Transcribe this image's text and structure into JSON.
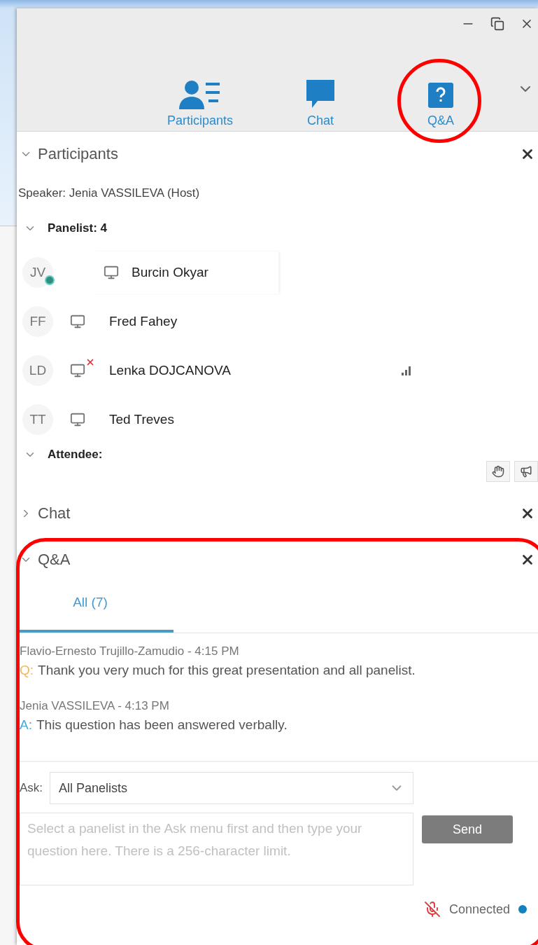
{
  "toolbar": {
    "tabs": [
      {
        "kind": "participants",
        "label": "Participants"
      },
      {
        "kind": "chat",
        "label": "Chat"
      },
      {
        "kind": "qa",
        "label": "Q&A"
      }
    ]
  },
  "participants": {
    "title": "Participants",
    "expanded": true,
    "speaker_label": "Speaker:",
    "speaker": "Jenia VASSILEVA (Host)",
    "groups": [
      {
        "title": "Panelist: 4",
        "expanded": true,
        "members": [
          {
            "initials": "JV",
            "name": "Burcin Okyar",
            "popup": true,
            "status_badge": true,
            "video_blocked": false,
            "signal": false
          },
          {
            "initials": "FF",
            "name": "Fred Fahey",
            "popup": false,
            "status_badge": false,
            "video_blocked": false,
            "signal": false
          },
          {
            "initials": "LD",
            "name": "Lenka DOJCANOVA",
            "popup": false,
            "status_badge": false,
            "video_blocked": true,
            "signal": true
          },
          {
            "initials": "TT",
            "name": "Ted Treves",
            "popup": false,
            "status_badge": false,
            "video_blocked": false,
            "signal": false
          }
        ]
      },
      {
        "title": "Attendee:",
        "expanded": true
      }
    ]
  },
  "chat": {
    "title": "Chat",
    "expanded": false
  },
  "qa": {
    "title": "Q&A",
    "expanded": true,
    "tabs": [
      {
        "label": "All (7)",
        "selected": true
      }
    ],
    "messages": [
      {
        "author": "Flavio-Ernesto Trujillo-Zamudio - 4:15 PM",
        "kind": "question",
        "prefix": "Q:",
        "text": "Thank you very much for this great presentation and all panelist."
      },
      {
        "author": "Jenia VASSILEVA - 4:13 PM",
        "kind": "answer",
        "prefix": "A:",
        "text": "This question has been answered verbally."
      }
    ],
    "ask_label": "Ask:",
    "ask_value": "All Panelists",
    "placeholder": "Select a panelist in the Ask menu first and then type your question here. There is a 256-character limit.",
    "send": "Send",
    "status": "Connected"
  }
}
